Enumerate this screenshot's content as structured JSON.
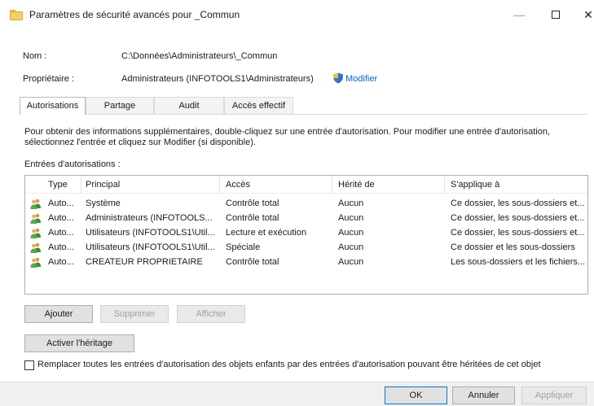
{
  "window": {
    "title": "Paramètres de sécurité avancés pour _Commun",
    "minimize_glyph": "—",
    "close_glyph": "✕"
  },
  "info": {
    "name_label": "Nom :",
    "name_value": "C:\\Données\\Administrateurs\\_Commun",
    "owner_label": "Propriétaire :",
    "owner_value": "Administrateurs (INFOTOOLS1\\Administrateurs)",
    "modify_link": "Modifier"
  },
  "tabs": [
    {
      "label": "Autorisations",
      "active": true
    },
    {
      "label": "Partage",
      "active": false
    },
    {
      "label": "Audit",
      "active": false
    },
    {
      "label": "Accès effectif",
      "active": false
    }
  ],
  "description": "Pour obtenir des informations supplémentaires, double-cliquez sur une entrée d'autorisation. Pour modifier une entrée d'autorisation, sélectionnez l'entrée et cliquez sur Modifier (si disponible).",
  "entries_label": "Entrées d'autorisations :",
  "table": {
    "columns": [
      "Type",
      "Principal",
      "Accès",
      "Hérité de",
      "S'applique à"
    ],
    "rows": [
      [
        "Auto...",
        "Système",
        "Contrôle total",
        "Aucun",
        "Ce dossier, les sous-dossiers et..."
      ],
      [
        "Auto...",
        "Administrateurs (INFOTOOLS...",
        "Contrôle total",
        "Aucun",
        "Ce dossier, les sous-dossiers et..."
      ],
      [
        "Auto...",
        "Utilisateurs (INFOTOOLS1\\Util...",
        "Lecture et exécution",
        "Aucun",
        "Ce dossier, les sous-dossiers et..."
      ],
      [
        "Auto...",
        "Utilisateurs (INFOTOOLS1\\Util...",
        "Spéciale",
        "Aucun",
        "Ce dossier et les sous-dossiers"
      ],
      [
        "Auto...",
        "CREATEUR PROPRIETAIRE",
        "Contrôle total",
        "Aucun",
        "Les sous-dossiers et les fichiers..."
      ]
    ]
  },
  "buttons": {
    "add": "Ajouter",
    "remove": "Supprimer",
    "view": "Afficher",
    "enable_inheritance": "Activer l'héritage",
    "ok": "OK",
    "cancel": "Annuler",
    "apply": "Appliquer"
  },
  "checkbox": {
    "label": "Remplacer toutes les entrées d'autorisation des objets enfants par des entrées d'autorisation pouvant être héritées de cet objet",
    "checked": false
  },
  "colors": {
    "link": "#0066cc",
    "primary_border": "#0078d7"
  }
}
